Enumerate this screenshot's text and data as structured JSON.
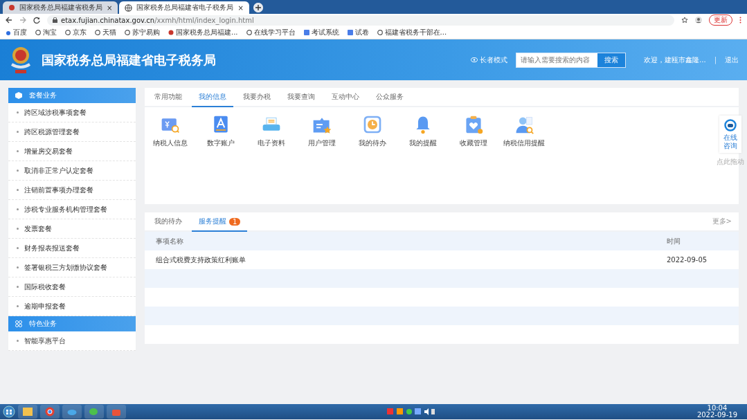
{
  "browser": {
    "tabs": [
      {
        "title": "国家税务总局福建省税务局",
        "close": "×",
        "selected": false
      },
      {
        "title": "国家税务总局福建省电子税务局",
        "close": "×",
        "selected": true
      }
    ],
    "url_host": "etax.fujian.chinatax.gov.cn",
    "url_path": "/xxmh/html/index_login.html",
    "update_button": "更新",
    "bookmarks": [
      "百度",
      "淘宝",
      "京东",
      "天猫",
      "苏宁易购",
      "国家税务总局福建...",
      "在线学习平台",
      "考试系统",
      "试卷",
      "福建省税务干部在..."
    ]
  },
  "header": {
    "title": "国家税务总局福建省电子税务局",
    "elder_mode": "长者模式",
    "search": {
      "placeholder": "请输入需要搜索的内容",
      "button": "搜索"
    },
    "welcome": "欢迎，建瓯市鑫隆...",
    "separator": "|",
    "logout": "退出"
  },
  "sidebar": {
    "sections": [
      {
        "title": "套餐业务",
        "items": [
          "跨区域涉税事项套餐",
          "跨区税源管理套餐",
          "增量房交易套餐",
          "取消非正常户认定套餐",
          "注销前置事项办理套餐",
          "涉税专业服务机构管理套餐",
          "发票套餐",
          "财务报表报送套餐",
          "签署银税三方划缴协议套餐",
          "国际税收套餐",
          "逾期申报套餐"
        ]
      },
      {
        "title": "特色业务",
        "items": [
          "智能享惠平台"
        ]
      }
    ]
  },
  "top_tabs": [
    {
      "label": "常用功能",
      "selected": false
    },
    {
      "label": "我的信息",
      "selected": true
    },
    {
      "label": "我要办税",
      "selected": false
    },
    {
      "label": "我要查询",
      "selected": false
    },
    {
      "label": "互动中心",
      "selected": false
    },
    {
      "label": "公众服务",
      "selected": false
    }
  ],
  "tiles": [
    "纳税人信息",
    "数字账户",
    "电子资料",
    "用户管理",
    "我的待办",
    "我的提醒",
    "收藏管理",
    "纳税信用提醒"
  ],
  "bottom_tabs": [
    {
      "label": "我的待办",
      "selected": false
    },
    {
      "label": "服务提醒",
      "selected": true,
      "badge": "1"
    }
  ],
  "more": "更多>",
  "table": {
    "columns": [
      "事项名称",
      "时间"
    ],
    "rows": [
      [
        "组合式税费支持政策红利账单",
        "2022-09-05"
      ]
    ]
  },
  "float_widget": {
    "label": "在线咨询",
    "hint": "点此拖动"
  },
  "taskbar": {
    "time": "10:04",
    "date": "2022-09-19"
  }
}
